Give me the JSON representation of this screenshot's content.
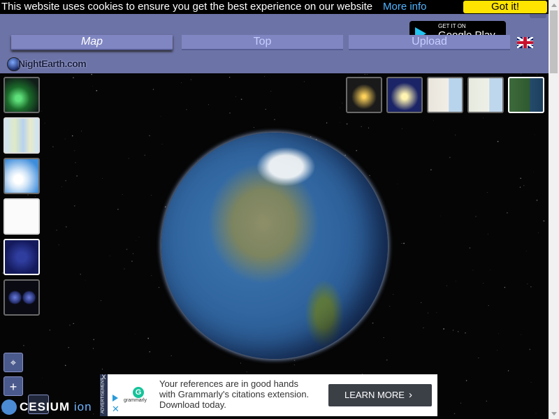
{
  "cookie_bar": {
    "message": "This website uses cookies to ensure you get the best experience on our website",
    "more_info": "More info",
    "accept": "Got it!"
  },
  "header": {
    "tabs": [
      {
        "label": "Map",
        "active": true
      },
      {
        "label": "Top",
        "active": false
      },
      {
        "label": "Upload",
        "active": false
      }
    ],
    "play_badge": {
      "small": "GET IT ON",
      "big": "Google Play"
    },
    "language_icon": "uk-flag-icon",
    "logo_text": "NightEarth.com",
    "colors": {
      "header_bg": "#6c73a6",
      "tab_bg": "#7f86c2"
    }
  },
  "viewer": {
    "left_layers": [
      {
        "name": "aurora-layer",
        "icon": "aurora-thumbnail"
      },
      {
        "name": "world-map-layer",
        "icon": "world-map-thumbnail"
      },
      {
        "name": "clouds-layer",
        "icon": "clouds-thumbnail"
      },
      {
        "name": "political-map-layer",
        "icon": "political-map-thumbnail"
      },
      {
        "name": "night-lights-layer",
        "icon": "night-lights-thumbnail"
      },
      {
        "name": "two-globes-layer",
        "icon": "two-globes-thumbnail"
      }
    ],
    "top_layers": [
      {
        "name": "city-lights-layer",
        "icon": "city-lights-thumbnail",
        "selected": false
      },
      {
        "name": "city-lights-blue-layer",
        "icon": "city-lights-blue-thumbnail",
        "selected": false
      },
      {
        "name": "road-map-layer",
        "icon": "road-map-thumbnail",
        "selected": false
      },
      {
        "name": "street-map-layer",
        "icon": "street-map-thumbnail",
        "selected": false
      },
      {
        "name": "satellite-layer",
        "icon": "satellite-thumbnail",
        "selected": true
      }
    ],
    "controls": {
      "locate_icon": "crosshair-icon",
      "zoom_in": "+",
      "zoom_out": "−"
    },
    "credits": {
      "cesium": "CESIUM",
      "ion": "ion"
    }
  },
  "ad": {
    "side_label": "ADVERTISEMENT",
    "close": "X",
    "brand": "grammarly",
    "brand_letter": "G",
    "text": "Your references are in good hands with Grammarly's citations extension. Download today.",
    "cta": "LEARN MORE",
    "cta_arrow": "›"
  }
}
